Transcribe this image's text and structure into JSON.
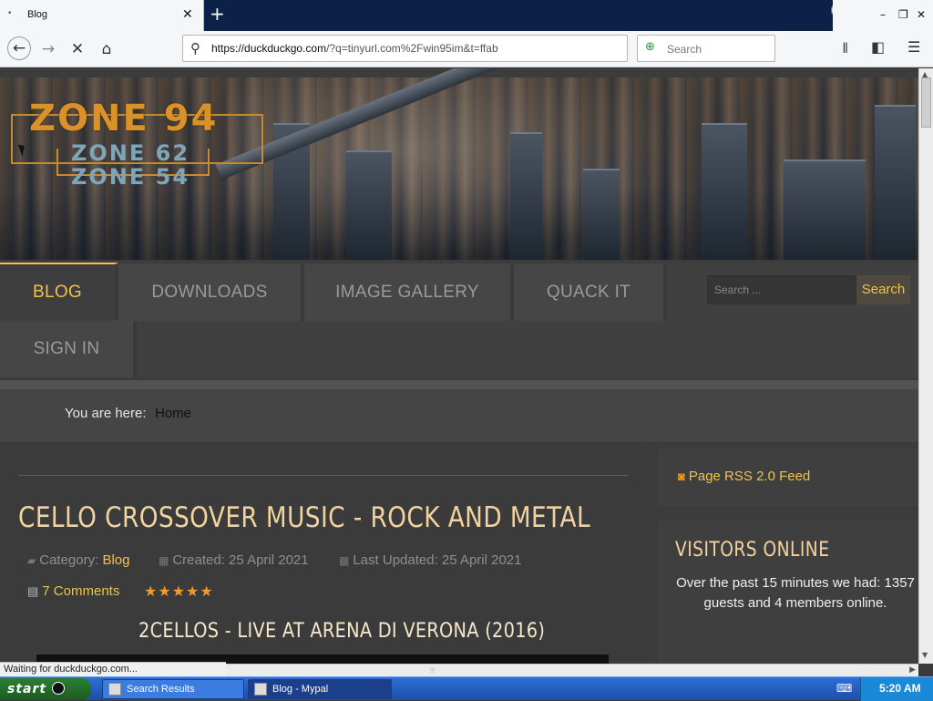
{
  "browser": {
    "tab": {
      "favicon": "•",
      "title": "Blog",
      "close": "✕"
    },
    "new_tab": "+",
    "window_controls": {
      "minimize": "–",
      "restore": "❐",
      "close": "✕"
    },
    "nav": {
      "back": "←",
      "forward": "→",
      "stop": "✕",
      "home": "⌂"
    },
    "url": {
      "host": "https://duckduckgo.com",
      "path": "/?q=tinyurl.com%2Fwin95im&t=ffab"
    },
    "search_placeholder": "Search",
    "toolbar": {
      "library": "𝍪",
      "sidebar": "◧",
      "menu": "☰"
    },
    "status": "Waiting for duckduckgo.com..."
  },
  "site": {
    "logo": {
      "main": "ZONE 94",
      "sub1": "ZONE 62",
      "sub2": "ZONE 54"
    },
    "menu": [
      {
        "label": "BLOG",
        "active": true
      },
      {
        "label": "DOWNLOADS",
        "active": false
      },
      {
        "label": "IMAGE GALLERY",
        "active": false
      },
      {
        "label": "QUACK IT",
        "active": false
      },
      {
        "label": "SIGN IN",
        "active": false
      }
    ],
    "search": {
      "placeholder": "Search ...",
      "button": "Search"
    },
    "breadcrumb": {
      "label": "You are here:",
      "home": "Home"
    },
    "article": {
      "title": "CELLO CROSSOVER MUSIC - ROCK AND METAL",
      "category_label": "Category:",
      "category": "Blog",
      "created": "Created: 25 April 2021",
      "updated": "Last Updated: 25 April 2021",
      "comments": "7 Comments",
      "rating_stars": "★★★★★",
      "rating": 5,
      "subtitle": "2CELLOS - LIVE AT ARENA DI VERONA (2016)"
    },
    "sidebar": {
      "rss": "Page RSS 2.0 Feed",
      "visitors_title": "VISITORS ONLINE",
      "visitors_text": "Over the past 15 minutes we had: 1357 guests and 4 members online."
    }
  },
  "taskbar": {
    "start": "start",
    "tasks": [
      "Search Results",
      "Blog - Mypal"
    ],
    "time": "5:20 AM"
  },
  "colors": {
    "accent": "#efc14d",
    "title": "#f2d3a0",
    "page_bg": "#3c3c3c"
  }
}
